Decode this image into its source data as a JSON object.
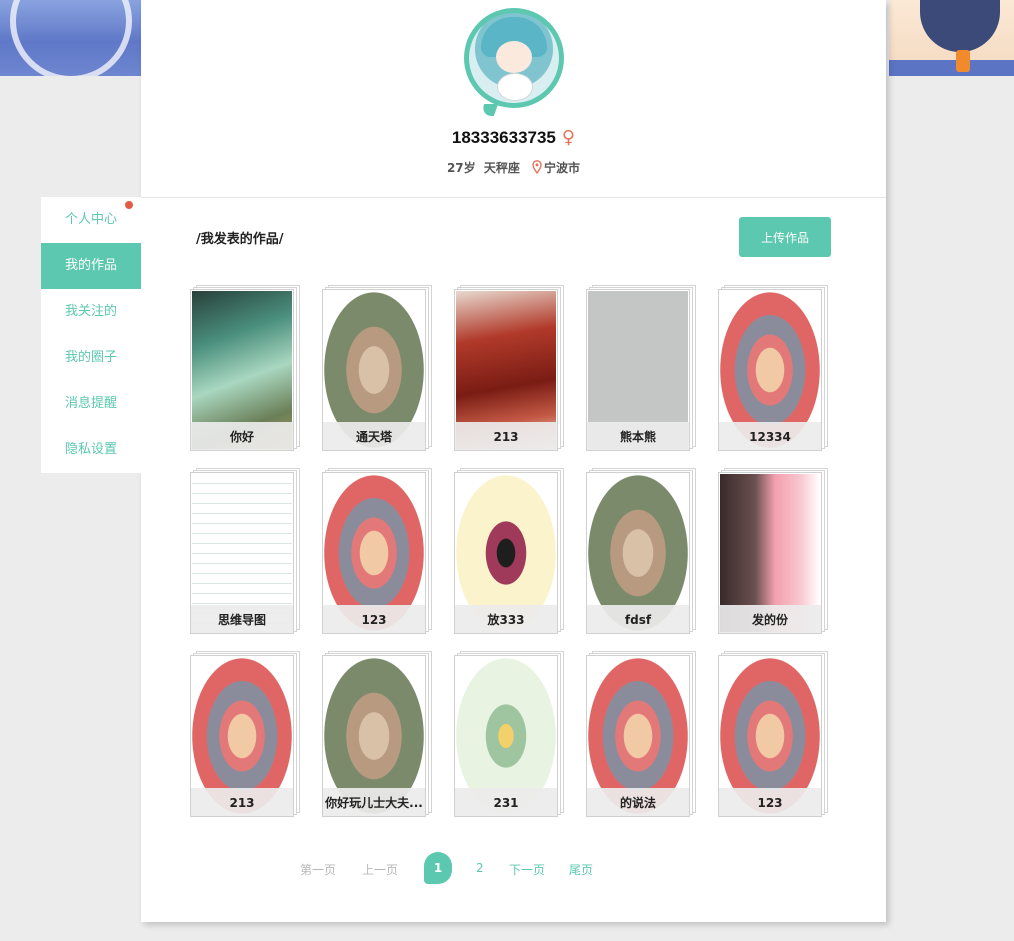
{
  "profile": {
    "username": "18333633735",
    "gender_symbol": "♀",
    "age": "27岁",
    "zodiac": "天秤座",
    "city": "宁波市"
  },
  "sidebar": {
    "items": [
      {
        "label": "个人中心",
        "active": false
      },
      {
        "label": "我的作品",
        "active": true
      },
      {
        "label": "我关注的",
        "active": false
      },
      {
        "label": "我的圈子",
        "active": false
      },
      {
        "label": "消息提醒",
        "active": false
      },
      {
        "label": "隐私设置",
        "active": false
      }
    ]
  },
  "main": {
    "section_title": "/我发表的作品/",
    "upload_label": "上传作品",
    "works": [
      {
        "title": "你好"
      },
      {
        "title": "通天塔"
      },
      {
        "title": "213"
      },
      {
        "title": "熊本熊"
      },
      {
        "title": "12334"
      },
      {
        "title": "思维导图"
      },
      {
        "title": "123"
      },
      {
        "title": "放333"
      },
      {
        "title": "fdsf"
      },
      {
        "title": "发的份"
      },
      {
        "title": "213"
      },
      {
        "title": "你好玩儿士大夫..."
      },
      {
        "title": "231"
      },
      {
        "title": "的说法"
      },
      {
        "title": "123"
      }
    ]
  },
  "pagination": {
    "first": "第一页",
    "prev": "上一页",
    "current": "1",
    "page2": "2",
    "next": "下一页",
    "last": "尾页"
  },
  "colors": {
    "accent": "#5cc8b0",
    "notify_dot": "#e35b45",
    "gender": "#e2735c"
  },
  "icons": {
    "gender": "female-icon",
    "location": "location-pin-icon"
  }
}
